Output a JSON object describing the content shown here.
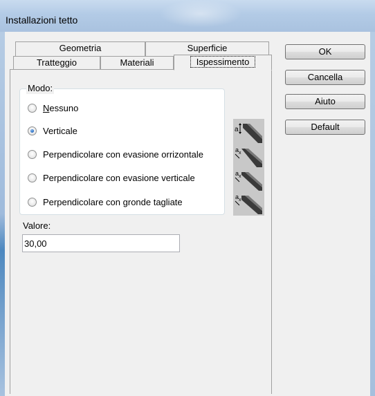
{
  "window": {
    "title": "Installazioni tetto"
  },
  "tabs": {
    "row_back": [
      {
        "label": "Geometria"
      },
      {
        "label": "Superficie"
      }
    ],
    "row_front": [
      {
        "label": "Tratteggio"
      },
      {
        "label": "Materiali"
      },
      {
        "label": "Ispessimento",
        "selected": true
      }
    ]
  },
  "modo": {
    "legend": "Modo:",
    "selected_index": 1,
    "options": [
      {
        "label_first": "N",
        "label_rest": "essuno"
      },
      {
        "label_first": "",
        "label_rest": "Verticale"
      },
      {
        "label_first": "",
        "label_rest": "Perpendicolare con evasione orrizontale"
      },
      {
        "label_first": "",
        "label_rest": "Perpendicolare con evasione verticale"
      },
      {
        "label_first": "",
        "label_rest": "Perpendicolare con gronde tagliate"
      }
    ],
    "illustrations": [
      {
        "icon": "vertical-thickness-icon",
        "letter": "a"
      },
      {
        "icon": "perpendicular-horizontal-eaves-icon",
        "letter": "a"
      },
      {
        "icon": "perpendicular-vertical-eaves-icon",
        "letter": "a"
      },
      {
        "icon": "perpendicular-cut-gutter-icon",
        "letter": "a"
      }
    ]
  },
  "valore": {
    "label": "Valore:",
    "value": "30,00"
  },
  "buttons": {
    "ok": "OK",
    "cancel": "Cancella",
    "help": "Aiuto",
    "default": "Default"
  },
  "colors": {
    "titlebar": "#b3cbe6",
    "dialog_bg": "#f0f0f0",
    "radio_selected": "#2d6fc4"
  }
}
